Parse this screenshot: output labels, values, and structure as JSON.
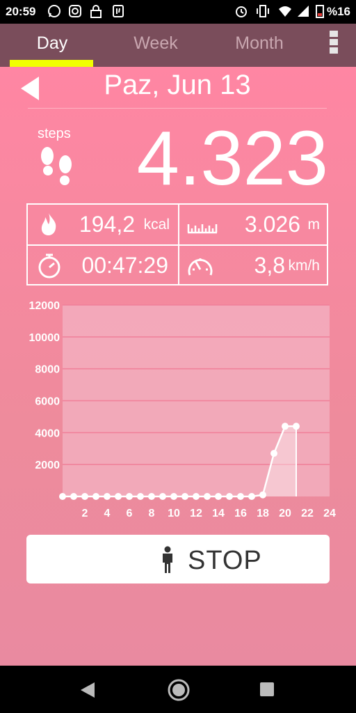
{
  "status_bar": {
    "time": "20:59",
    "battery": "%16"
  },
  "tabs": [
    {
      "label": "Day",
      "active": true
    },
    {
      "label": "Week",
      "active": false
    },
    {
      "label": "Month",
      "active": false
    }
  ],
  "header": {
    "date": "Paz, Jun 13"
  },
  "steps": {
    "label": "steps",
    "value": "4.323"
  },
  "stats": {
    "calories": {
      "value": "194,2",
      "unit": "kcal"
    },
    "distance": {
      "value": "3.026",
      "unit": "m"
    },
    "duration": {
      "value": "00:47:29",
      "unit": ""
    },
    "speed": {
      "value": "3,8",
      "unit": "km/h"
    }
  },
  "chart_data": {
    "type": "area",
    "xlabel": "",
    "ylabel": "",
    "x_ticks": [
      "2",
      "4",
      "6",
      "8",
      "10",
      "12",
      "14",
      "16",
      "18",
      "20",
      "22",
      "24"
    ],
    "y_ticks": [
      "2000",
      "4000",
      "6000",
      "8000",
      "10000",
      "12000"
    ],
    "xlim": [
      0,
      24
    ],
    "ylim": [
      0,
      12000
    ],
    "grid": true,
    "x": [
      0,
      1,
      2,
      3,
      4,
      5,
      6,
      7,
      8,
      9,
      10,
      11,
      12,
      13,
      14,
      15,
      16,
      17,
      18,
      19,
      20,
      21
    ],
    "values": [
      0,
      0,
      0,
      0,
      0,
      0,
      0,
      0,
      0,
      0,
      0,
      0,
      0,
      0,
      0,
      0,
      0,
      0,
      100,
      2700,
      4400,
      4400
    ]
  },
  "stop_button": {
    "label": "STOP"
  },
  "icons": {
    "calories": "flame-icon",
    "distance": "ruler-icon",
    "duration": "stopwatch-icon",
    "speed": "speedometer-icon"
  },
  "colors": {
    "accent": "#f1ff00",
    "tabbar": "#7a4d5b",
    "background": "#ff86a3"
  }
}
